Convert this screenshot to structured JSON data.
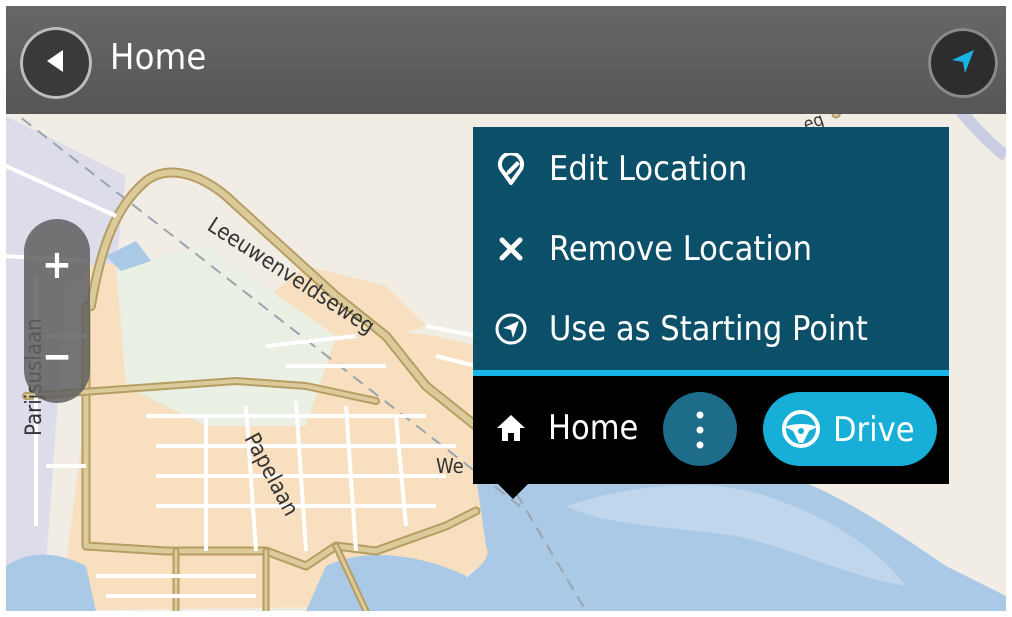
{
  "header": {
    "title": "Home",
    "back_icon": "back-arrow-icon",
    "locate_icon": "location-arrow-icon"
  },
  "map": {
    "street_labels": [
      "Leeuwenveldseweg",
      "Papelaan",
      "Parijsuslaan",
      "We",
      "eg"
    ]
  },
  "zoom": {
    "zoom_in_label": "+",
    "zoom_out_label": "−"
  },
  "popup": {
    "menu_items": [
      {
        "label": "Edit Location",
        "icon": "edit-location-icon"
      },
      {
        "label": "Remove Location",
        "icon": "close-icon"
      },
      {
        "label": "Use as Starting Point",
        "icon": "starting-point-icon"
      }
    ],
    "footer": {
      "location_name": "Home",
      "location_icon": "home-icon",
      "more_icon": "more-vertical-icon",
      "drive_label": "Drive",
      "drive_icon": "steering-wheel-icon"
    }
  },
  "colors": {
    "top_bar": "#5e5e5f",
    "popup_menu": "#0c4f68",
    "popup_divider": "#17b6e6",
    "popup_footer": "#000000",
    "drive_button": "#17aed8",
    "more_button": "#1d6d8a",
    "water": "#a9c9e7",
    "built_area": "#f7dfbf",
    "road": "#d7c08f",
    "land": "#f1ede4"
  }
}
